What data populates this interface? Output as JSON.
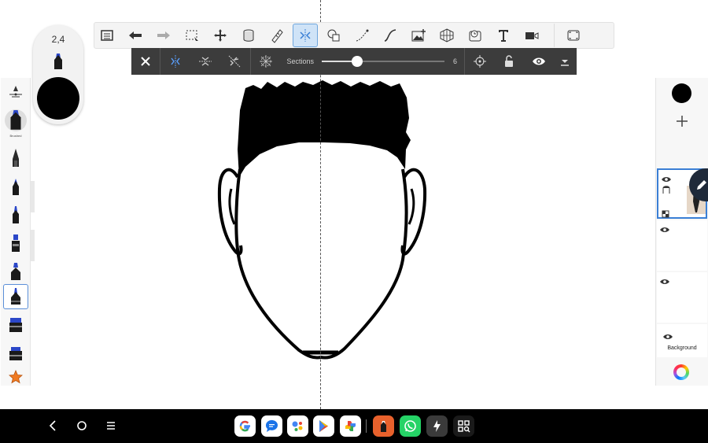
{
  "brush_panel": {
    "size": "2,4",
    "color": "#000000"
  },
  "toolbar": {
    "items": [
      {
        "name": "gallery-icon"
      },
      {
        "name": "undo-icon"
      },
      {
        "name": "redo-icon"
      },
      {
        "name": "selection-icon"
      },
      {
        "name": "transform-icon"
      },
      {
        "name": "fill-icon"
      },
      {
        "name": "ruler-icon"
      },
      {
        "name": "symmetry-icon",
        "active": true
      },
      {
        "name": "shapes-icon"
      },
      {
        "name": "stroke-icon"
      },
      {
        "name": "curve-icon"
      },
      {
        "name": "import-image-icon"
      },
      {
        "name": "perspective-icon"
      },
      {
        "name": "time-lapse-icon"
      },
      {
        "name": "text-icon"
      },
      {
        "name": "record-icon"
      },
      {
        "name": "fullscreen-icon"
      }
    ],
    "accent_color": "#3a7fd5"
  },
  "symmetry_bar": {
    "sections_label": "Sections",
    "sections_value": "6",
    "slider_fraction": 0.29
  },
  "left_tools": {
    "brush_name": "Brushed",
    "items": [
      {
        "name": "brush-settings-icon"
      },
      {
        "name": "current-brush-icon"
      },
      {
        "name": "pencil-brush-icon"
      },
      {
        "name": "pen-brush-icon"
      },
      {
        "name": "ink-brush-icon"
      },
      {
        "name": "marker-brush-icon"
      },
      {
        "name": "airbrush-icon"
      },
      {
        "name": "selected-brush-icon",
        "selected": true
      },
      {
        "name": "chisel-marker-icon"
      },
      {
        "name": "wide-marker-icon"
      },
      {
        "name": "favorites-star-icon"
      }
    ]
  },
  "layers": {
    "background_label": "Background",
    "active_layer_border": "#3a7fd5"
  },
  "navbar": {
    "dock_apps": [
      {
        "name": "google-app-icon"
      },
      {
        "name": "messages-app-icon"
      },
      {
        "name": "assistant-app-icon"
      },
      {
        "name": "play-store-app-icon"
      },
      {
        "name": "photos-app-icon"
      },
      {
        "name": "sketchbook-app-icon"
      },
      {
        "name": "whatsapp-app-icon"
      },
      {
        "name": "shortcut-app-icon"
      },
      {
        "name": "app-drawer-icon"
      }
    ]
  }
}
